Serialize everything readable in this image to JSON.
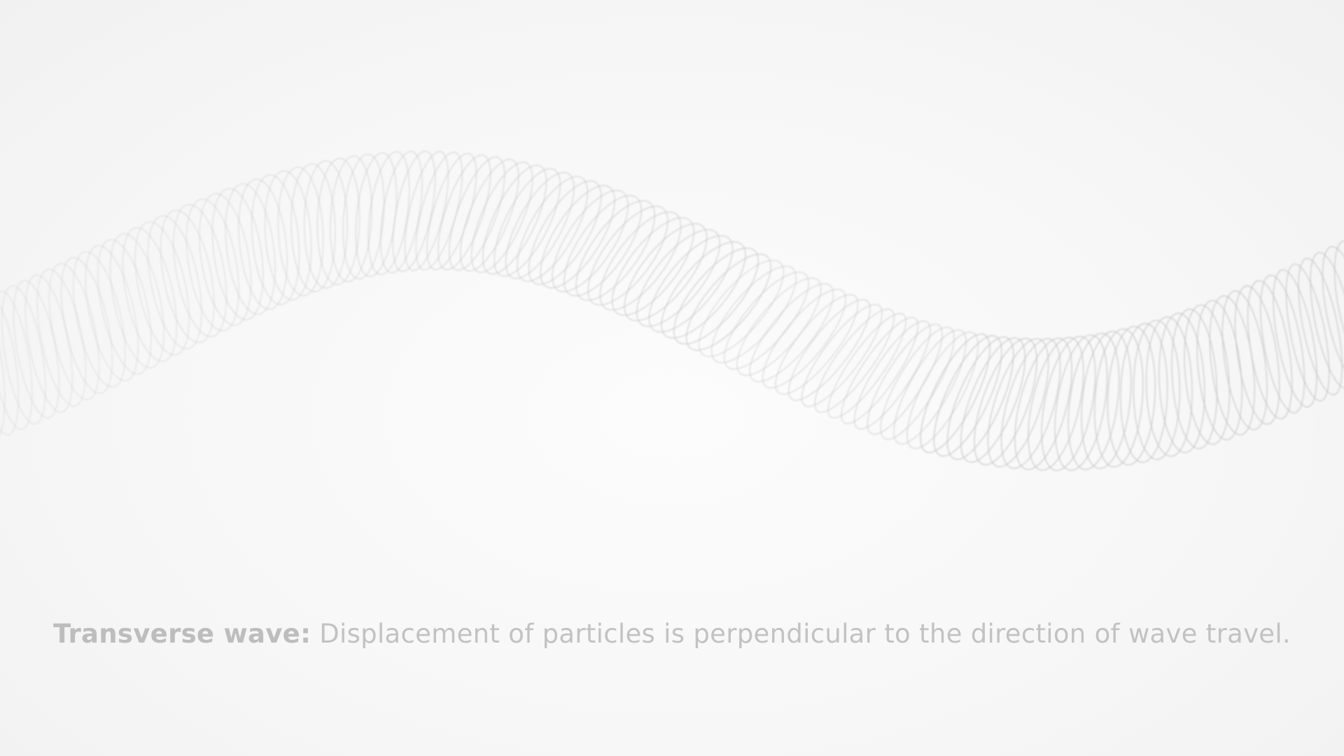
{
  "caption": {
    "term": "Transverse wave:",
    "description": " Displacement of particles is perpendicular to the direction of wave travel."
  },
  "colors": {
    "background": "#f6f6f6",
    "spring_stroke": "#c4c4c4",
    "caption_term": "#bdbdbd",
    "caption_description": "#c2c2c2"
  },
  "illustration": {
    "subject": "coiled-spring-icon",
    "motion": "transverse sine wave"
  }
}
